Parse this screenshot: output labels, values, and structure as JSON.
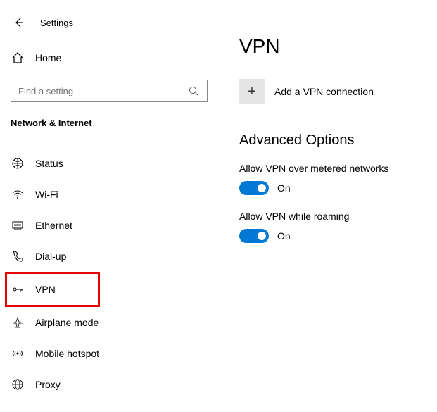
{
  "header": {
    "title": "Settings"
  },
  "home": {
    "label": "Home"
  },
  "search": {
    "placeholder": "Find a setting"
  },
  "section": {
    "title": "Network & Internet"
  },
  "nav": {
    "status": "Status",
    "wifi": "Wi-Fi",
    "ethernet": "Ethernet",
    "dialup": "Dial-up",
    "vpn": "VPN",
    "airplane": "Airplane mode",
    "hotspot": "Mobile hotspot",
    "proxy": "Proxy"
  },
  "main": {
    "title": "VPN",
    "add_label": "Add a VPN connection",
    "advanced_title": "Advanced Options",
    "opt1": {
      "label": "Allow VPN over metered networks",
      "state": "On"
    },
    "opt2": {
      "label": "Allow VPN while roaming",
      "state": "On"
    }
  }
}
